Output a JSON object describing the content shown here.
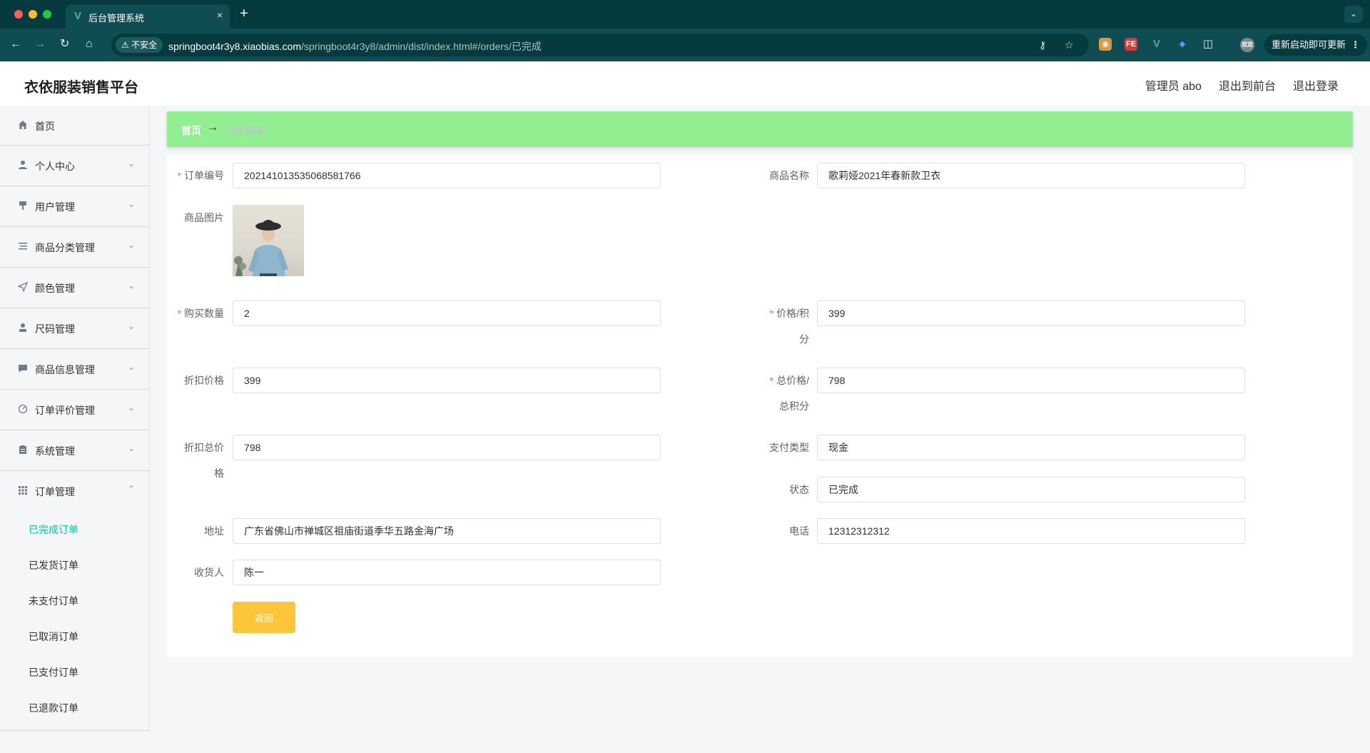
{
  "browser": {
    "tab_title": "后台管理系统",
    "tab_close": "×",
    "new_tab": "+",
    "tab_menu": "⌄",
    "insecure_label": "⚠ 不安全",
    "url_host": "springboot4r3y8.xiaobias.com",
    "url_path": "/springboot4r3y8/admin/dist/index.html#/orders/已完成",
    "update_label": "重新启动即可更新",
    "update_more": "⋮",
    "ext_fe": "FE",
    "ext_v": "V",
    "profile_label": "双双"
  },
  "header": {
    "brand": "衣依服装销售平台",
    "admin_label": "管理员 abo",
    "to_frontend": "退出到前台",
    "logout": "退出登录"
  },
  "sidebar": {
    "items": [
      {
        "label": "首页",
        "icon": "home-icon"
      },
      {
        "label": "个人中心",
        "icon": "user-icon"
      },
      {
        "label": "用户管理",
        "icon": "brush-icon"
      },
      {
        "label": "商品分类管理",
        "icon": "list-icon"
      },
      {
        "label": "颜色管理",
        "icon": "send-icon"
      },
      {
        "label": "尺码管理",
        "icon": "person-icon"
      },
      {
        "label": "商品信息管理",
        "icon": "message-icon"
      },
      {
        "label": "订单评价管理",
        "icon": "gauge-icon"
      },
      {
        "label": "系统管理",
        "icon": "clipboard-icon"
      },
      {
        "label": "订单管理",
        "icon": "grid-icon"
      }
    ],
    "sub_items": [
      "已完成订单",
      "已发货订单",
      "未支付订单",
      "已取消订单",
      "已支付订单",
      "已退款订单"
    ],
    "active_sub": "已完成订单"
  },
  "breadcrumb": {
    "home": "首页",
    "separator": "→",
    "current": "订单管理"
  },
  "form": {
    "order_no": {
      "label": "订单编号",
      "value": "202141013535068581766",
      "required": true
    },
    "product_name": {
      "label": "商品名称",
      "value": "歌莉娅2021年春新款卫衣"
    },
    "product_image": {
      "label": "商品图片"
    },
    "quantity": {
      "label": "购买数量",
      "value": "2",
      "required": true
    },
    "price": {
      "label_1": "价格/积",
      "label_2": "分",
      "value": "399",
      "required": true
    },
    "discount_price": {
      "label": "折扣价格",
      "value": "399"
    },
    "total": {
      "label_1": "总价格/",
      "label_2": "总积分",
      "value": "798",
      "required": true
    },
    "discount_total": {
      "label_1": "折扣总价",
      "label_2": "格",
      "value": "798"
    },
    "pay_type": {
      "label": "支付类型",
      "value": "现金"
    },
    "status": {
      "label": "状态",
      "value": "已完成"
    },
    "address": {
      "label": "地址",
      "value": "广东省佛山市禅城区祖庙街道季华五路金海广场"
    },
    "phone": {
      "label": "电话",
      "value": "12312312312"
    },
    "receiver": {
      "label": "收货人",
      "value": "陈一"
    },
    "back_button": "返回"
  },
  "colors": {
    "accent": "#00c9a7",
    "breadcrumb_bg": "#91ee91",
    "back_button": "#fbc63b",
    "required": "#f56c6c",
    "browser_dark": "#053a3f",
    "browser_mid": "#0f4d52"
  }
}
